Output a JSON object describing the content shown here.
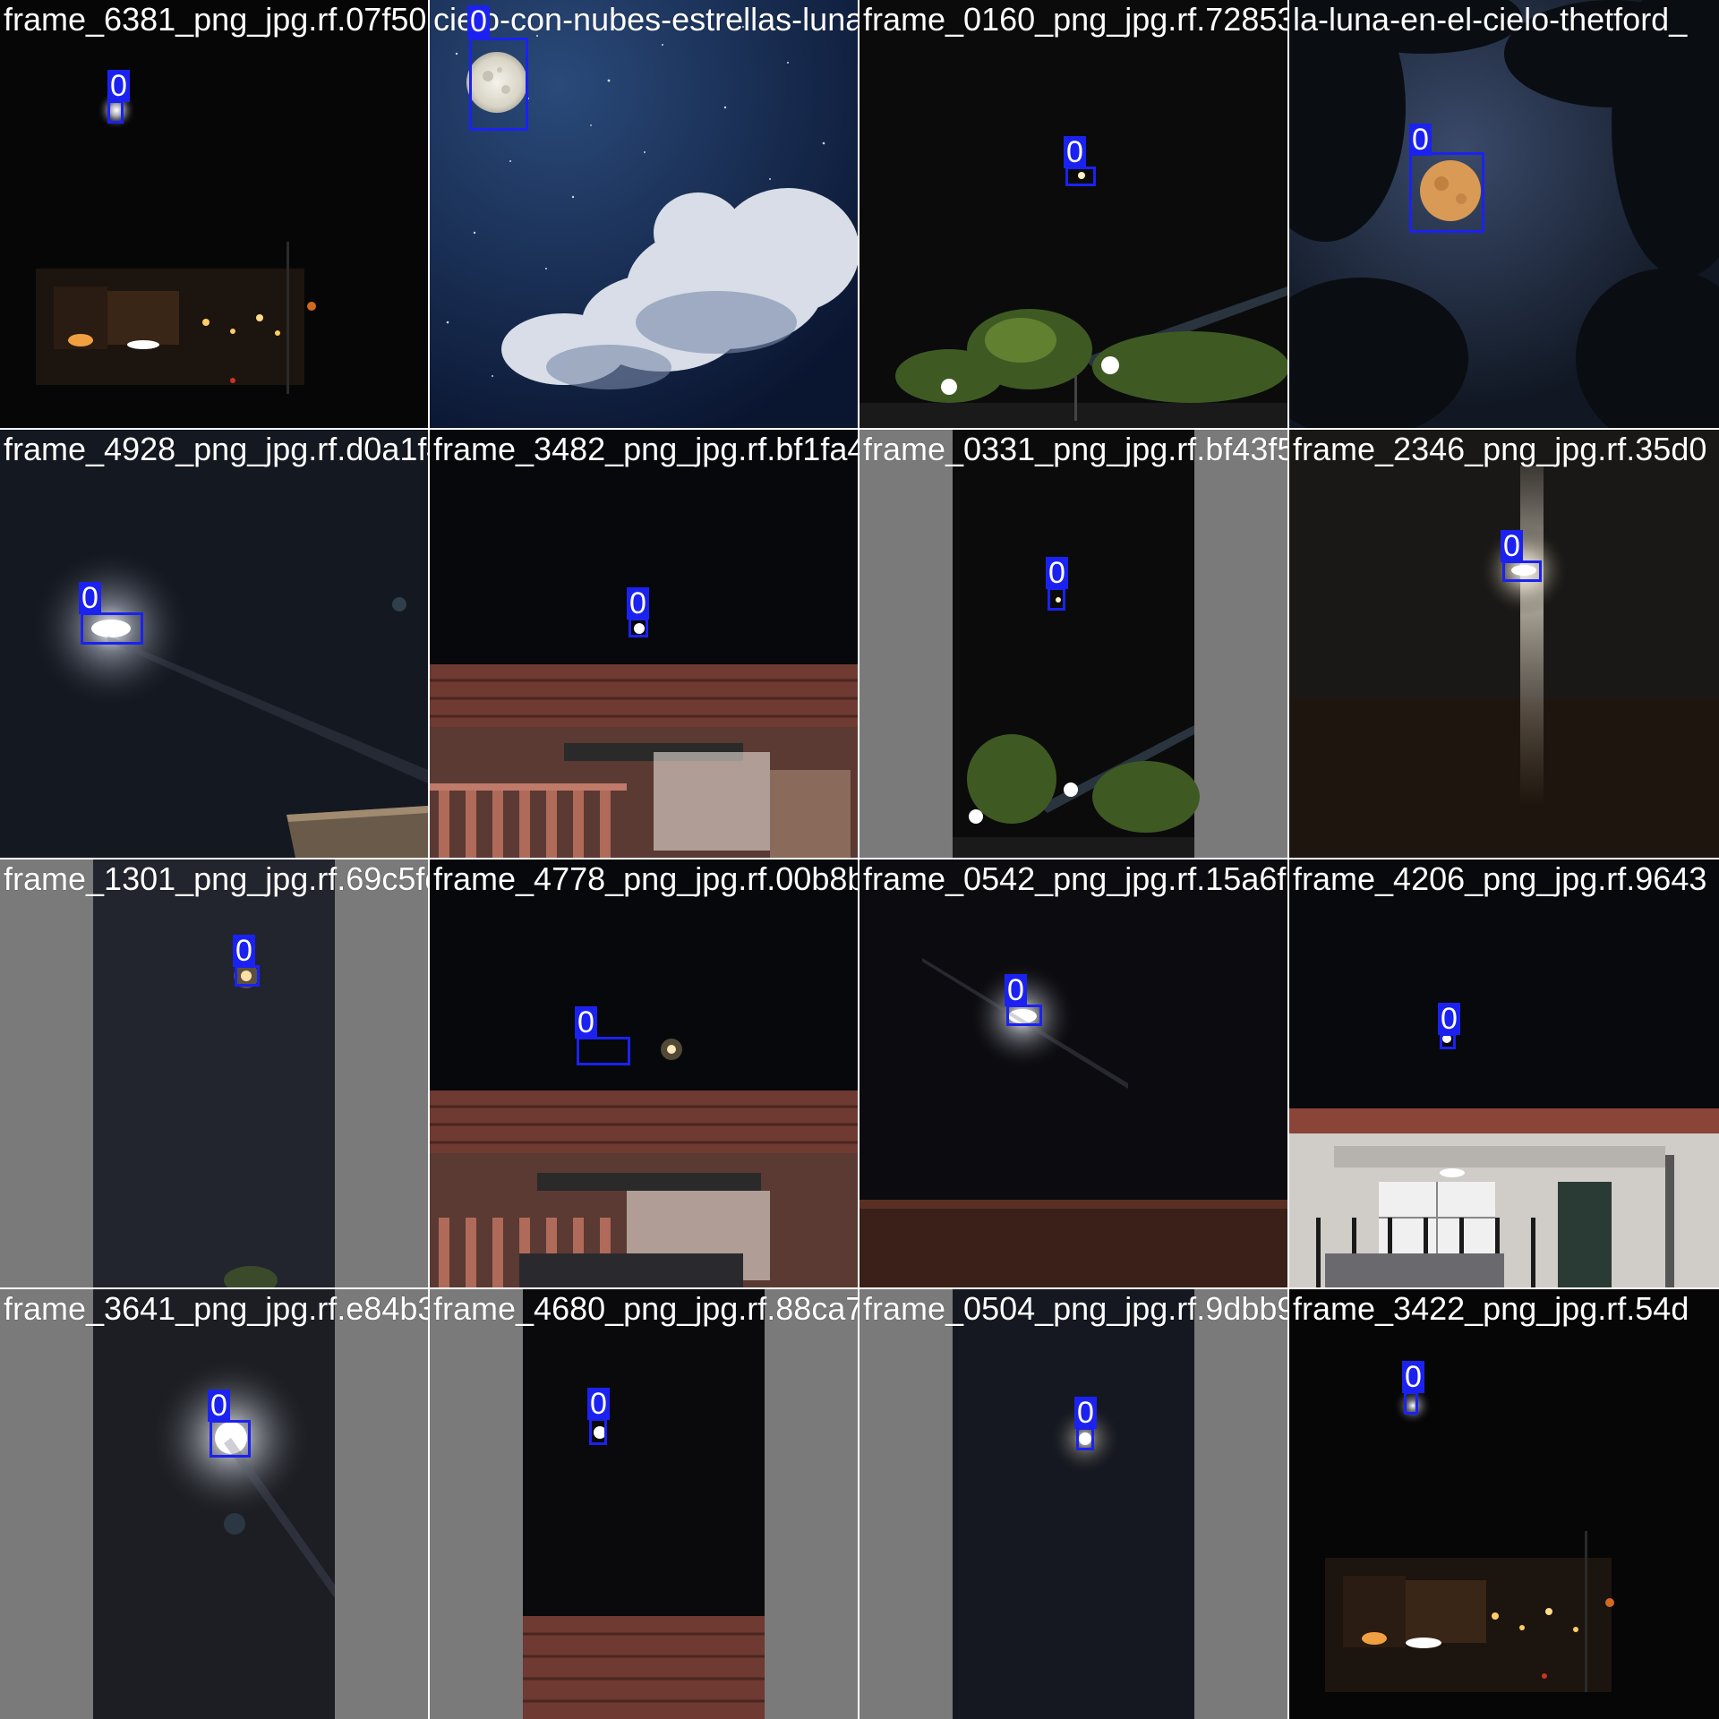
{
  "box_color": "#1b22f0",
  "tiles": [
    {
      "filename": "frame_6381_png_jpg.rf.07f50704f3daf33e52a",
      "label": "0",
      "scene": "night-street"
    },
    {
      "filename": "cielo-con-nubes-estrellas-luna-y-nubes",
      "label": "0",
      "scene": "starry-moon-clouds"
    },
    {
      "filename": "frame_0160_png_jpg.rf.72853adfaae50a4cc6",
      "label": "0",
      "scene": "park-lights"
    },
    {
      "filename": "la-luna-en-el-cielo-thetford_",
      "label": "0",
      "scene": "orange-moon-trees"
    },
    {
      "filename": "frame_4928_png_jpg.rf.d0a1f40039443322b73",
      "label": "0",
      "scene": "glow-sky"
    },
    {
      "filename": "frame_3482_png_jpg.rf.bf1fa4702c0353555",
      "label": "0",
      "scene": "roof-moon"
    },
    {
      "filename": "frame_0331_png_jpg.rf.bf43f5197c2376c896",
      "label": "0",
      "scene": "park-lights-pillar"
    },
    {
      "filename": "frame_2346_png_jpg.rf.35d0",
      "label": "0",
      "scene": "light-beam"
    },
    {
      "filename": "frame_1301_png_jpg.rf.69c5fd39e3b4786a38",
      "label": "0",
      "scene": "dark-pillar"
    },
    {
      "filename": "frame_4778_png_jpg.rf.00b8b94e045a2dc6e",
      "label": "0",
      "scene": "roof-moon-2"
    },
    {
      "filename": "frame_0542_png_jpg.rf.15a6fbae45256e1269",
      "label": "0",
      "scene": "dark-streak"
    },
    {
      "filename": "frame_4206_png_jpg.rf.9643",
      "label": "0",
      "scene": "house-facade"
    },
    {
      "filename": "frame_3641_png_jpg.rf.e84b3a64714538770",
      "label": "0",
      "scene": "bright-moon-pillar"
    },
    {
      "filename": "frame_4680_png_jpg.rf.88ca74be368d4c36c9",
      "label": "0",
      "scene": "roof-pillar"
    },
    {
      "filename": "frame_0504_png_jpg.rf.9dbb98f1384328163e",
      "label": "0",
      "scene": "dark-pillar-2"
    },
    {
      "filename": "frame_3422_png_jpg.rf.54d",
      "label": "0",
      "scene": "night-street-2"
    }
  ]
}
